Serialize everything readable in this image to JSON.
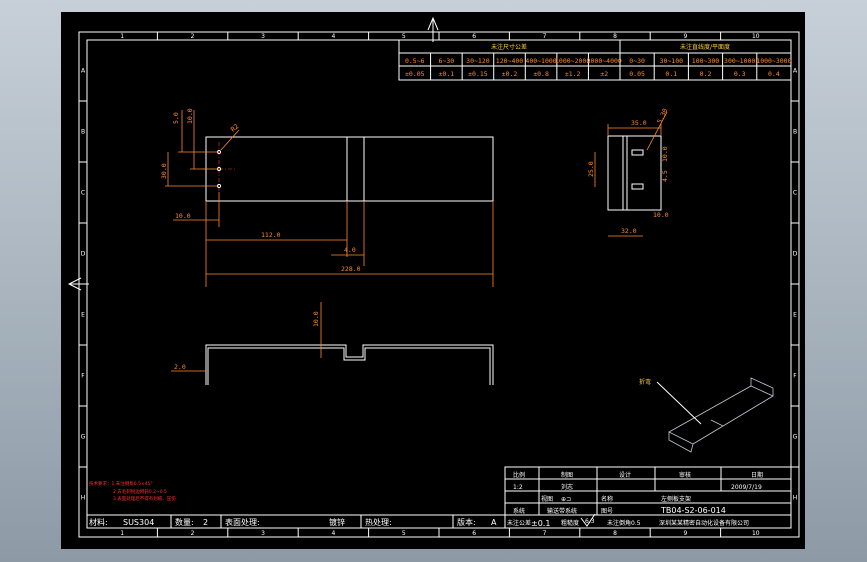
{
  "border": {
    "cols": [
      "1",
      "2",
      "3",
      "4",
      "5",
      "6",
      "7",
      "8",
      "9",
      "10"
    ],
    "rows": [
      "A",
      "B",
      "C",
      "D",
      "E",
      "F",
      "G",
      "H"
    ]
  },
  "tolerance_table": {
    "linear_title": "未注尺寸公差",
    "angular_title": "未注直线度/平面度",
    "linear_ranges": [
      "0.5~6",
      "6~30",
      "30~120",
      "120~400",
      "400~1000",
      "1000~2000",
      "2000~4000"
    ],
    "linear_values": [
      "±0.05",
      "±0.1",
      "±0.15",
      "±0.2",
      "±0.8",
      "±1.2",
      "±2"
    ],
    "flat_ranges": [
      "0~30",
      "30~100",
      "100~300",
      "300~1000",
      "1000~3000"
    ],
    "flat_values": [
      "0.05",
      "0.1",
      "0.2",
      "0.3",
      "0.4"
    ]
  },
  "dimensions": {
    "top_a": "5.0",
    "top_b": "10.0",
    "side_a": "30.0",
    "hole": "R2",
    "left_off": "10.0",
    "mid_len": "112.0",
    "step": "4.0",
    "total_len": "228.0",
    "height": "10.0",
    "thick": "2.0",
    "r_view_top": "35.0",
    "r_view_slot": "5.30",
    "r_view_h": "25.0",
    "r_view_d1": "10.0",
    "r_view_d2": "4.5",
    "r_view_d3": "10.0",
    "r_view_w": "32.0"
  },
  "iso_label": "折弯",
  "notes": [
    "技术要求：1.未注倒角0.5×45°",
    "2.去毛刺锐边倒钝0.2~0.5",
    "3.表面处理后不得有划痕、压伤"
  ],
  "title_block": {
    "headers": [
      "比例",
      "制图",
      "设计",
      "审核",
      "日期"
    ],
    "scale": "1:2",
    "drafter": "刘志",
    "date": "2009/7/19",
    "projection_label": "视图",
    "name_label": "名称",
    "part_name": "左侧板支架",
    "system_label": "系统",
    "system_value": "输送带系统",
    "drawing_no_label": "图号",
    "drawing_no": "TB04-S2-06-014",
    "tolerance_label": "未注公差",
    "tolerance_value": "±0.1",
    "roughness_label": "粗糙度",
    "roughness_value": "6.3",
    "general_label": "未注倒角0.5",
    "company": "深圳某某精密自动化设备有限公司"
  },
  "bottom_bar": {
    "material_label": "材料:",
    "material": "SUS304",
    "qty_label": "数量:",
    "qty": "2",
    "surface_label": "表面处理:",
    "surface": "镀锌",
    "heat_label": "热处理:",
    "heat": "",
    "version_label": "版本:",
    "version": "A"
  }
}
